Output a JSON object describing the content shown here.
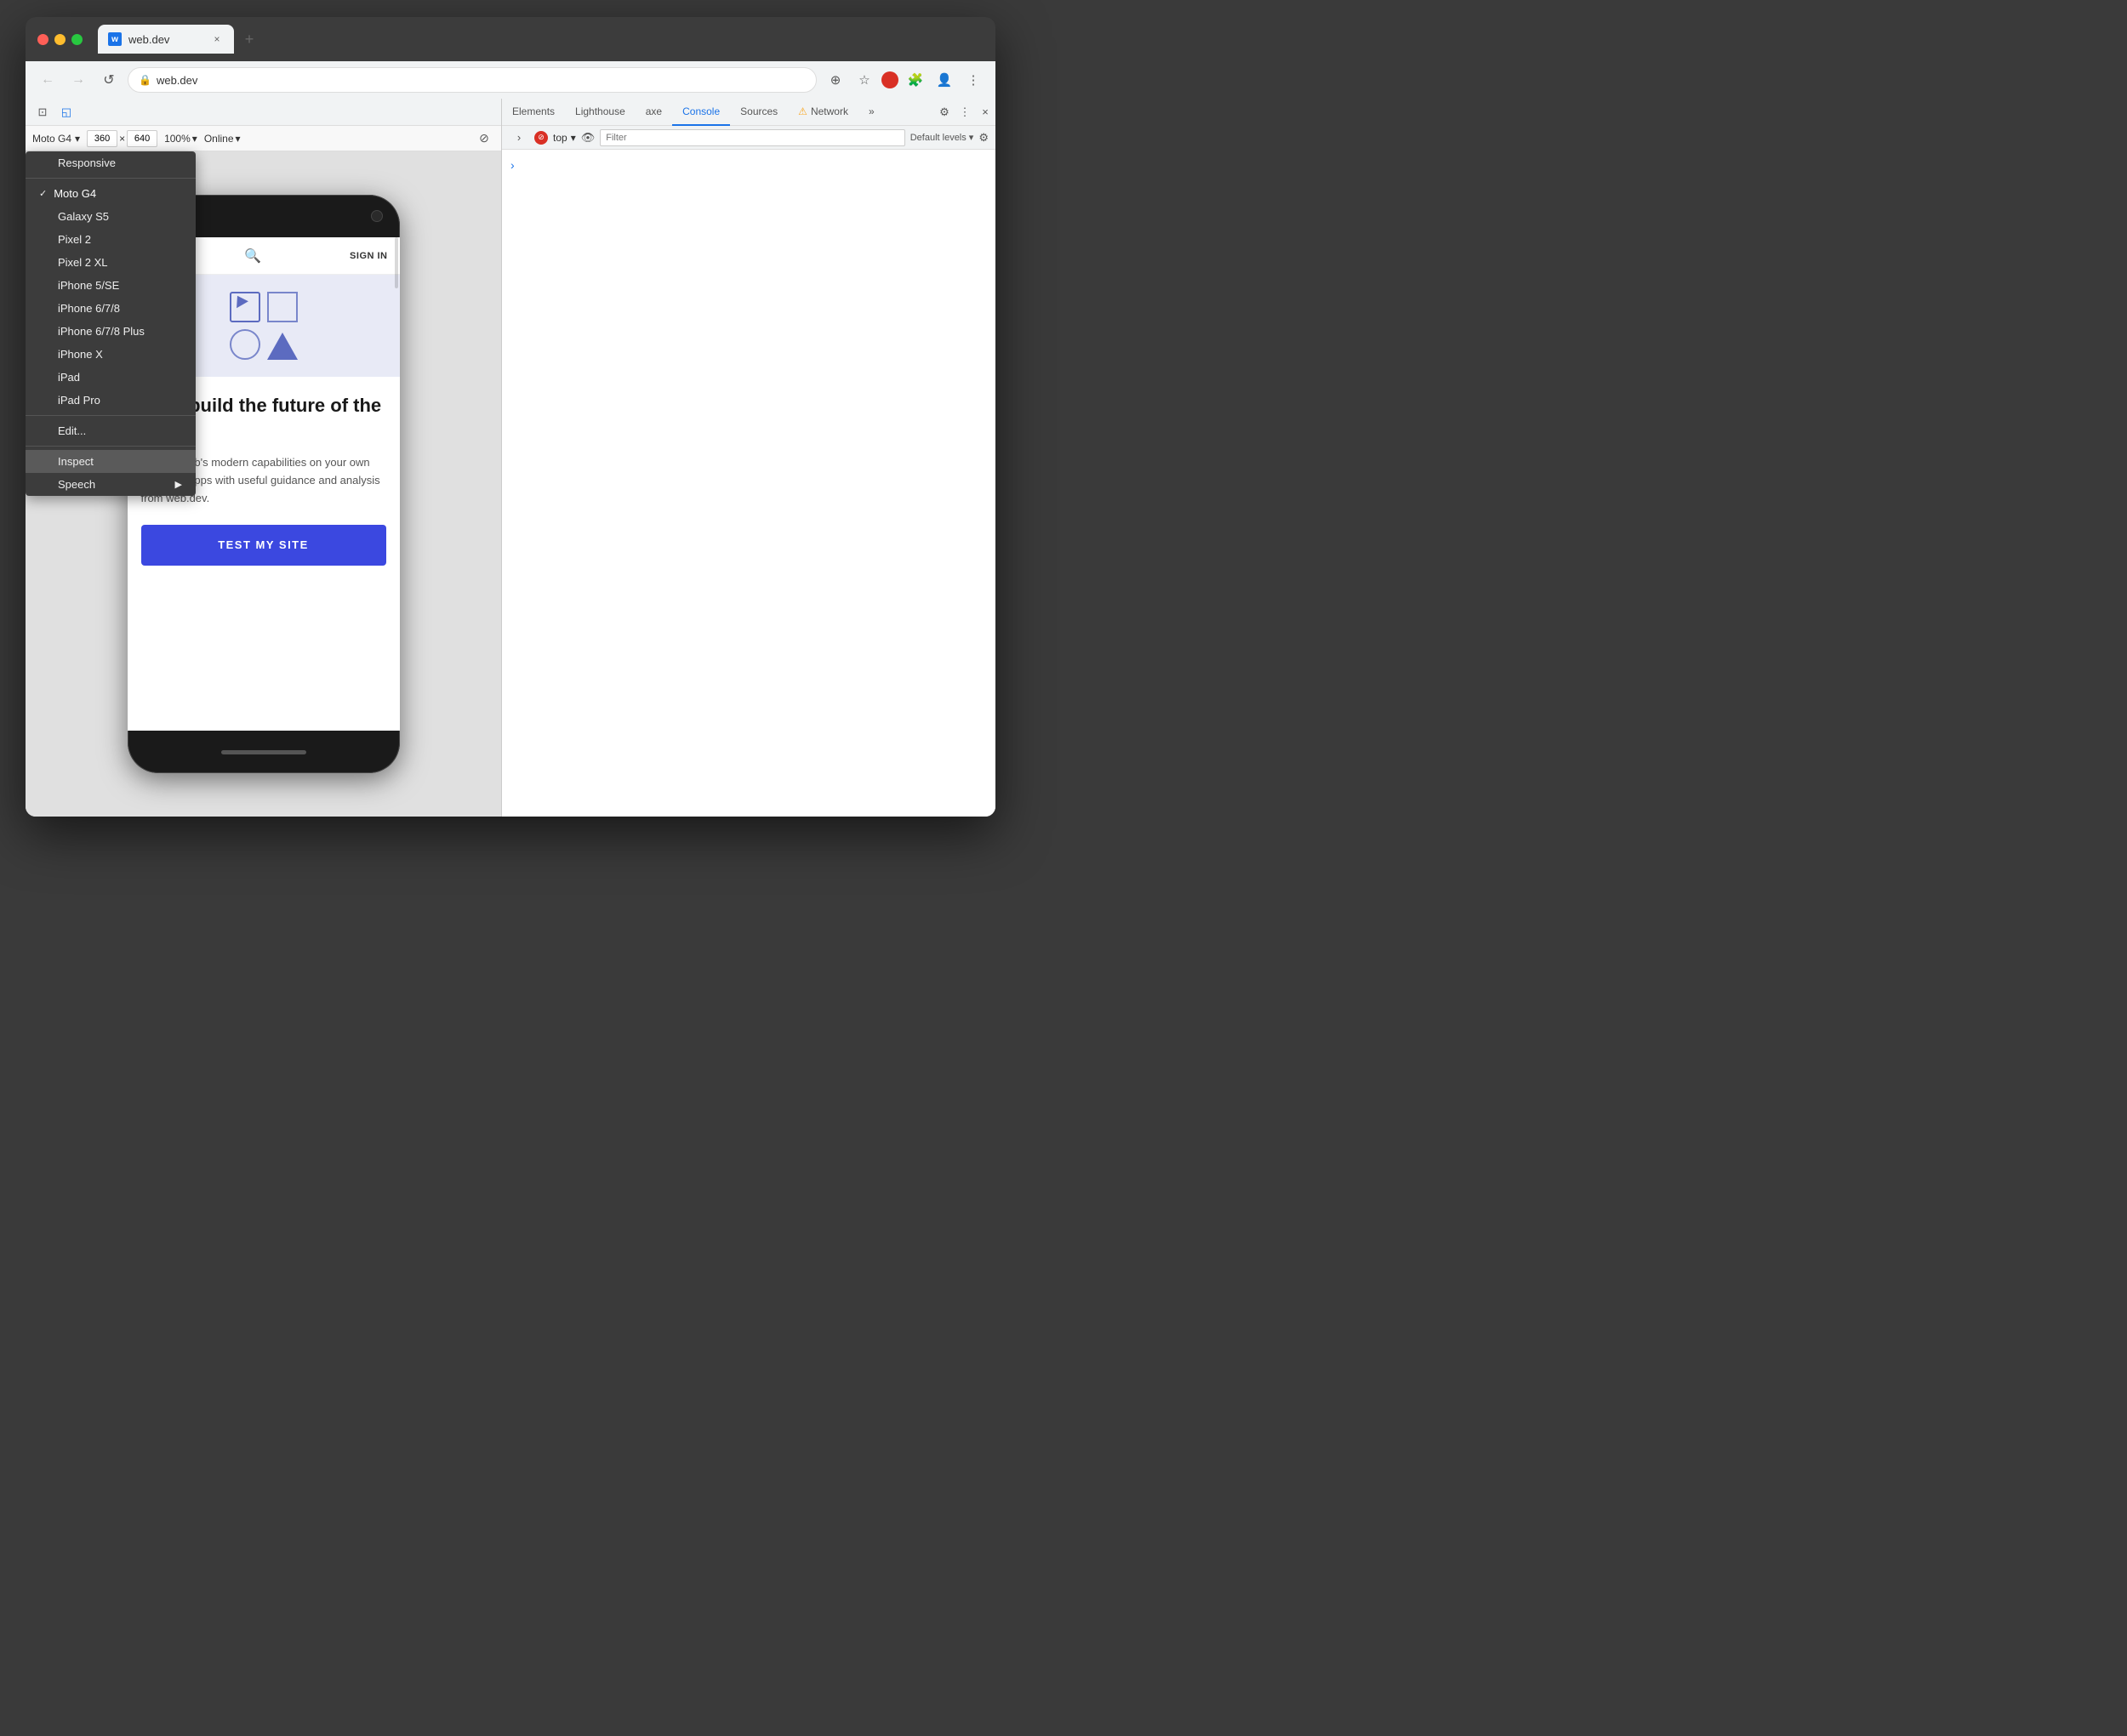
{
  "browser": {
    "tab": {
      "favicon_label": "w",
      "title": "web.dev",
      "close_label": "×"
    },
    "new_tab_label": "+",
    "address": "web.dev",
    "lock_icon": "🔒",
    "nav": {
      "back_label": "←",
      "forward_label": "→",
      "reload_label": "↺"
    },
    "toolbar_icons": [
      "⊕",
      "☆",
      "🧩",
      "👤",
      "⋮"
    ]
  },
  "devtools_top": {
    "device_icon": "📱",
    "responsive_icon": "◱",
    "device_name": "Moto G4",
    "width": "360",
    "cross": "×",
    "height": "640",
    "zoom": "100%",
    "zoom_arrow": "▾",
    "online": "Online",
    "online_arrow": "▾",
    "settings_icon": "⚙",
    "more_icon": "⋮",
    "close_icon": "×"
  },
  "dropdown": {
    "items": [
      {
        "id": "responsive",
        "label": "Responsive",
        "selected": false,
        "separator_after": false
      },
      {
        "id": "moto-g4",
        "label": "Moto G4",
        "selected": true,
        "separator_after": false
      },
      {
        "id": "galaxy-s5",
        "label": "Galaxy S5",
        "selected": false,
        "separator_after": false
      },
      {
        "id": "pixel-2",
        "label": "Pixel 2",
        "selected": false,
        "separator_after": false
      },
      {
        "id": "pixel-2-xl",
        "label": "Pixel 2 XL",
        "selected": false,
        "separator_after": false
      },
      {
        "id": "iphone-5se",
        "label": "iPhone 5/SE",
        "selected": false,
        "separator_after": false
      },
      {
        "id": "iphone-678",
        "label": "iPhone 6/7/8",
        "selected": false,
        "separator_after": false
      },
      {
        "id": "iphone-678-plus",
        "label": "iPhone 6/7/8 Plus",
        "selected": false,
        "separator_after": false
      },
      {
        "id": "iphone-x",
        "label": "iPhone X",
        "selected": false,
        "separator_after": false
      },
      {
        "id": "ipad",
        "label": "iPad",
        "selected": false,
        "separator_after": false
      },
      {
        "id": "ipad-pro",
        "label": "iPad Pro",
        "selected": false,
        "separator_after": true
      },
      {
        "id": "edit",
        "label": "Edit...",
        "selected": false,
        "separator_after": false
      }
    ],
    "context_items": [
      {
        "id": "inspect",
        "label": "Inspect",
        "highlight": true
      },
      {
        "id": "speech",
        "label": "Speech",
        "has_arrow": true
      }
    ]
  },
  "devtools_tabs": {
    "tabs": [
      {
        "id": "elements",
        "label": "Elements",
        "active": false
      },
      {
        "id": "lighthouse",
        "label": "Lighthouse",
        "active": false
      },
      {
        "id": "axe",
        "label": "axe",
        "active": false
      },
      {
        "id": "console",
        "label": "Console",
        "active": true
      },
      {
        "id": "sources",
        "label": "Sources",
        "active": false
      },
      {
        "id": "network",
        "label": "Network",
        "active": false,
        "warning": true
      }
    ],
    "more_label": "»",
    "settings_icon": "⚙",
    "more_dots": "⋮",
    "close_icon": "×"
  },
  "console_toolbar": {
    "arrow": "›",
    "stop_label": "⊘",
    "context_label": "top",
    "context_arrow": "▾",
    "eye_icon": "👁",
    "filter_placeholder": "Filter",
    "level_label": "Default levels",
    "level_arrow": "▾",
    "gear_icon": "⚙"
  },
  "phone_content": {
    "nav_signin": "SIGN IN",
    "hero_heading": "Let's build the future of the web",
    "hero_body": "Get the web's modern capabilities on your own sites and apps with useful guidance and analysis from web.dev.",
    "cta_label": "TEST MY SITE"
  }
}
